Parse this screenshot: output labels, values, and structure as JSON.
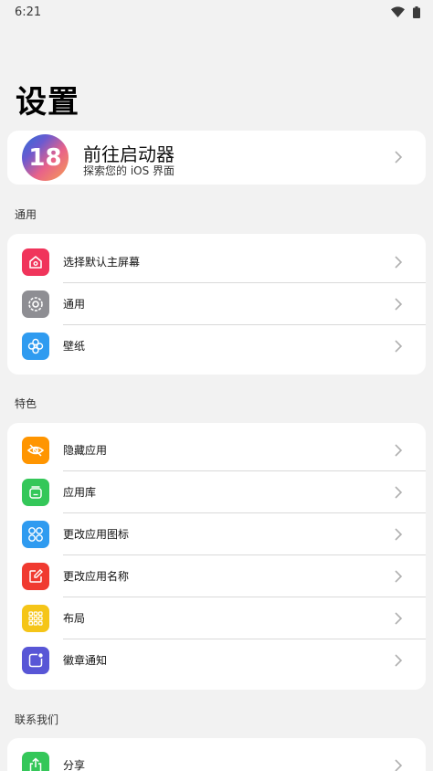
{
  "status": {
    "time": "6:21",
    "wifi_icon": "wifi-icon",
    "battery_icon": "battery-icon"
  },
  "page": {
    "title": "设置"
  },
  "launcher": {
    "badge": "18",
    "title": "前往启动器",
    "subtitle": "探索您的 iOS 界面"
  },
  "sections": {
    "general": {
      "title": "通用",
      "items": [
        {
          "label": "选择默认主屏幕",
          "icon": "home-icon",
          "color": "#f0345b"
        },
        {
          "label": "通用",
          "icon": "gear-icon",
          "color": "#8e8e93"
        },
        {
          "label": "壁纸",
          "icon": "flower-icon",
          "color": "#2f9bf0"
        }
      ]
    },
    "features": {
      "title": "特色",
      "items": [
        {
          "label": "隐藏应用",
          "icon": "eye-slash-icon",
          "color": "#ff9500"
        },
        {
          "label": "应用库",
          "icon": "app-library-icon",
          "color": "#34c759"
        },
        {
          "label": "更改应用图标",
          "icon": "grid-circles-icon",
          "color": "#2f9bf0"
        },
        {
          "label": "更改应用名称",
          "icon": "edit-icon",
          "color": "#f03a30"
        },
        {
          "label": "布局",
          "icon": "dots-grid-icon",
          "color": "#f5c518"
        },
        {
          "label": "徽章通知",
          "icon": "badge-icon",
          "color": "#5856d6"
        }
      ]
    },
    "contact": {
      "title": "联系我们",
      "items": [
        {
          "label": "分享",
          "icon": "share-icon",
          "color": "#34c759"
        }
      ]
    }
  }
}
